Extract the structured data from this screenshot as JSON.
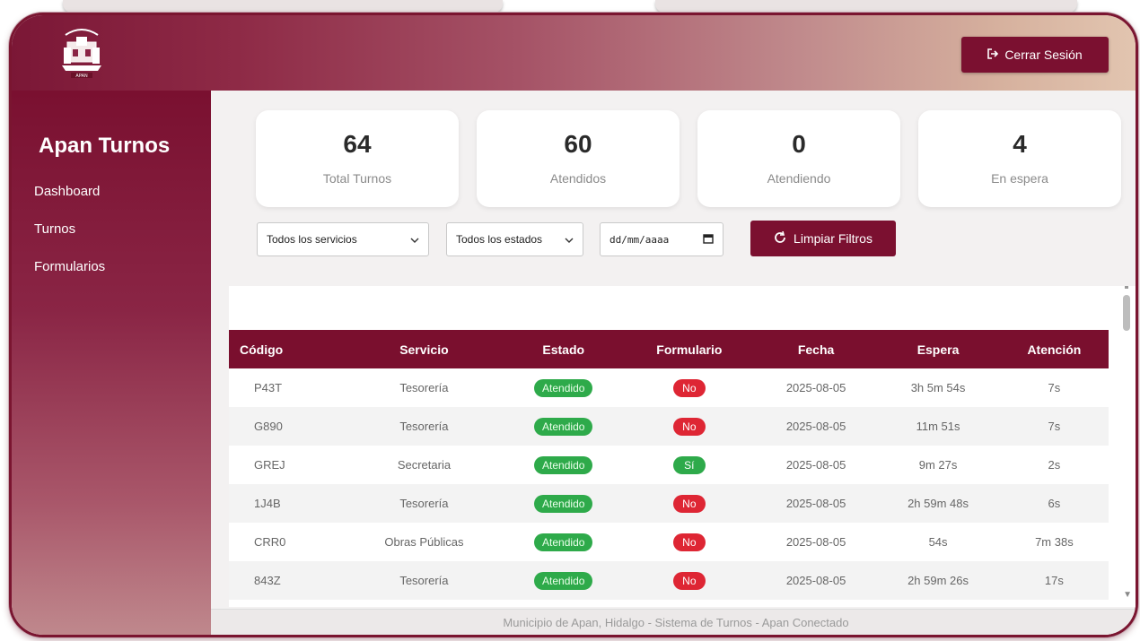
{
  "header": {
    "logo_text": "APAN",
    "logout_label": "Cerrar Sesión"
  },
  "sidebar": {
    "brand": "Apan Turnos",
    "items": [
      {
        "label": "Dashboard"
      },
      {
        "label": "Turnos"
      },
      {
        "label": "Formularios"
      }
    ]
  },
  "stats": [
    {
      "value": "64",
      "label": "Total Turnos"
    },
    {
      "value": "60",
      "label": "Atendidos"
    },
    {
      "value": "0",
      "label": "Atendiendo"
    },
    {
      "value": "4",
      "label": "En espera"
    }
  ],
  "filters": {
    "service": "Todos los servicios",
    "status": "Todos los estados",
    "date_placeholder": "dd/mm/aaaa",
    "clear_label": "Limpiar Filtros"
  },
  "table": {
    "columns": [
      "Código",
      "Servicio",
      "Estado",
      "Formulario",
      "Fecha",
      "Espera",
      "Atención"
    ],
    "rows": [
      {
        "codigo": "P43T",
        "servicio": "Tesorería",
        "estado": "Atendido",
        "formulario": "No",
        "fecha": "2025-08-05",
        "espera": "3h 5m 54s",
        "atencion": "7s"
      },
      {
        "codigo": "G890",
        "servicio": "Tesorería",
        "estado": "Atendido",
        "formulario": "No",
        "fecha": "2025-08-05",
        "espera": "11m 51s",
        "atencion": "7s"
      },
      {
        "codigo": "GREJ",
        "servicio": "Secretaria",
        "estado": "Atendido",
        "formulario": "Sí",
        "fecha": "2025-08-05",
        "espera": "9m 27s",
        "atencion": "2s"
      },
      {
        "codigo": "1J4B",
        "servicio": "Tesorería",
        "estado": "Atendido",
        "formulario": "No",
        "fecha": "2025-08-05",
        "espera": "2h 59m 48s",
        "atencion": "6s"
      },
      {
        "codigo": "CRR0",
        "servicio": "Obras Públicas",
        "estado": "Atendido",
        "formulario": "No",
        "fecha": "2025-08-05",
        "espera": "54s",
        "atencion": "7m 38s"
      },
      {
        "codigo": "843Z",
        "servicio": "Tesorería",
        "estado": "Atendido",
        "formulario": "No",
        "fecha": "2025-08-05",
        "espera": "2h 59m 26s",
        "atencion": "17s"
      }
    ]
  },
  "footer": {
    "text": "Municipio de Apan, Hidalgo - Sistema de Turnos - Apan Conectado"
  },
  "colors": {
    "primary": "#7b1030",
    "success": "#2eaa4a",
    "danger": "#de2634"
  }
}
